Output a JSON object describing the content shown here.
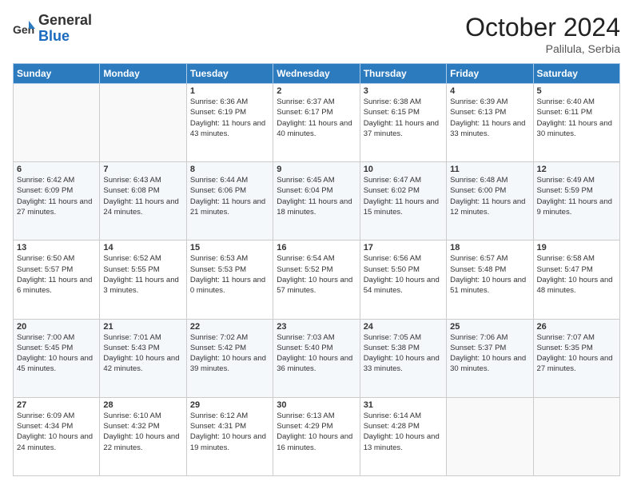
{
  "header": {
    "logo_general": "General",
    "logo_blue": "Blue",
    "month_title": "October 2024",
    "subtitle": "Palilula, Serbia"
  },
  "weekdays": [
    "Sunday",
    "Monday",
    "Tuesday",
    "Wednesday",
    "Thursday",
    "Friday",
    "Saturday"
  ],
  "weeks": [
    [
      {
        "day": null,
        "info": ""
      },
      {
        "day": null,
        "info": ""
      },
      {
        "day": "1",
        "info": "Sunrise: 6:36 AM\nSunset: 6:19 PM\nDaylight: 11 hours and 43 minutes."
      },
      {
        "day": "2",
        "info": "Sunrise: 6:37 AM\nSunset: 6:17 PM\nDaylight: 11 hours and 40 minutes."
      },
      {
        "day": "3",
        "info": "Sunrise: 6:38 AM\nSunset: 6:15 PM\nDaylight: 11 hours and 37 minutes."
      },
      {
        "day": "4",
        "info": "Sunrise: 6:39 AM\nSunset: 6:13 PM\nDaylight: 11 hours and 33 minutes."
      },
      {
        "day": "5",
        "info": "Sunrise: 6:40 AM\nSunset: 6:11 PM\nDaylight: 11 hours and 30 minutes."
      }
    ],
    [
      {
        "day": "6",
        "info": "Sunrise: 6:42 AM\nSunset: 6:09 PM\nDaylight: 11 hours and 27 minutes."
      },
      {
        "day": "7",
        "info": "Sunrise: 6:43 AM\nSunset: 6:08 PM\nDaylight: 11 hours and 24 minutes."
      },
      {
        "day": "8",
        "info": "Sunrise: 6:44 AM\nSunset: 6:06 PM\nDaylight: 11 hours and 21 minutes."
      },
      {
        "day": "9",
        "info": "Sunrise: 6:45 AM\nSunset: 6:04 PM\nDaylight: 11 hours and 18 minutes."
      },
      {
        "day": "10",
        "info": "Sunrise: 6:47 AM\nSunset: 6:02 PM\nDaylight: 11 hours and 15 minutes."
      },
      {
        "day": "11",
        "info": "Sunrise: 6:48 AM\nSunset: 6:00 PM\nDaylight: 11 hours and 12 minutes."
      },
      {
        "day": "12",
        "info": "Sunrise: 6:49 AM\nSunset: 5:59 PM\nDaylight: 11 hours and 9 minutes."
      }
    ],
    [
      {
        "day": "13",
        "info": "Sunrise: 6:50 AM\nSunset: 5:57 PM\nDaylight: 11 hours and 6 minutes."
      },
      {
        "day": "14",
        "info": "Sunrise: 6:52 AM\nSunset: 5:55 PM\nDaylight: 11 hours and 3 minutes."
      },
      {
        "day": "15",
        "info": "Sunrise: 6:53 AM\nSunset: 5:53 PM\nDaylight: 11 hours and 0 minutes."
      },
      {
        "day": "16",
        "info": "Sunrise: 6:54 AM\nSunset: 5:52 PM\nDaylight: 10 hours and 57 minutes."
      },
      {
        "day": "17",
        "info": "Sunrise: 6:56 AM\nSunset: 5:50 PM\nDaylight: 10 hours and 54 minutes."
      },
      {
        "day": "18",
        "info": "Sunrise: 6:57 AM\nSunset: 5:48 PM\nDaylight: 10 hours and 51 minutes."
      },
      {
        "day": "19",
        "info": "Sunrise: 6:58 AM\nSunset: 5:47 PM\nDaylight: 10 hours and 48 minutes."
      }
    ],
    [
      {
        "day": "20",
        "info": "Sunrise: 7:00 AM\nSunset: 5:45 PM\nDaylight: 10 hours and 45 minutes."
      },
      {
        "day": "21",
        "info": "Sunrise: 7:01 AM\nSunset: 5:43 PM\nDaylight: 10 hours and 42 minutes."
      },
      {
        "day": "22",
        "info": "Sunrise: 7:02 AM\nSunset: 5:42 PM\nDaylight: 10 hours and 39 minutes."
      },
      {
        "day": "23",
        "info": "Sunrise: 7:03 AM\nSunset: 5:40 PM\nDaylight: 10 hours and 36 minutes."
      },
      {
        "day": "24",
        "info": "Sunrise: 7:05 AM\nSunset: 5:38 PM\nDaylight: 10 hours and 33 minutes."
      },
      {
        "day": "25",
        "info": "Sunrise: 7:06 AM\nSunset: 5:37 PM\nDaylight: 10 hours and 30 minutes."
      },
      {
        "day": "26",
        "info": "Sunrise: 7:07 AM\nSunset: 5:35 PM\nDaylight: 10 hours and 27 minutes."
      }
    ],
    [
      {
        "day": "27",
        "info": "Sunrise: 6:09 AM\nSunset: 4:34 PM\nDaylight: 10 hours and 24 minutes."
      },
      {
        "day": "28",
        "info": "Sunrise: 6:10 AM\nSunset: 4:32 PM\nDaylight: 10 hours and 22 minutes."
      },
      {
        "day": "29",
        "info": "Sunrise: 6:12 AM\nSunset: 4:31 PM\nDaylight: 10 hours and 19 minutes."
      },
      {
        "day": "30",
        "info": "Sunrise: 6:13 AM\nSunset: 4:29 PM\nDaylight: 10 hours and 16 minutes."
      },
      {
        "day": "31",
        "info": "Sunrise: 6:14 AM\nSunset: 4:28 PM\nDaylight: 10 hours and 13 minutes."
      },
      {
        "day": null,
        "info": ""
      },
      {
        "day": null,
        "info": ""
      }
    ]
  ]
}
